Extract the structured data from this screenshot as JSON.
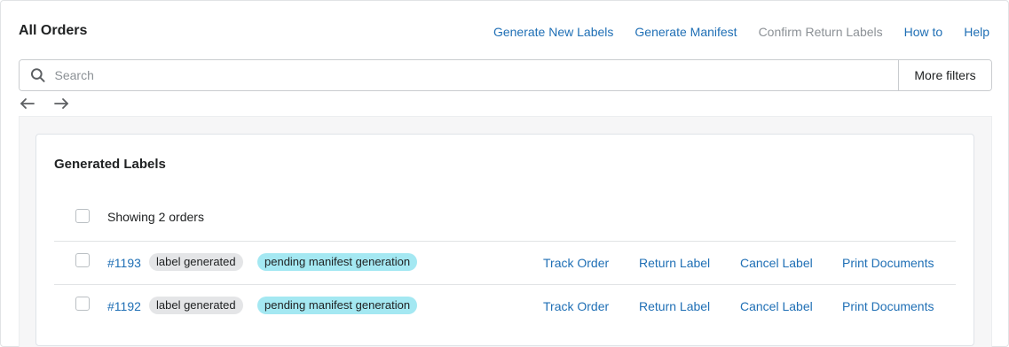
{
  "header": {
    "title": "All Orders",
    "actions": [
      {
        "label": "Generate New Labels",
        "enabled": true
      },
      {
        "label": "Generate Manifest",
        "enabled": true
      },
      {
        "label": "Confirm Return Labels",
        "enabled": false
      },
      {
        "label": "How to",
        "enabled": true
      },
      {
        "label": "Help",
        "enabled": true
      }
    ]
  },
  "search": {
    "placeholder": "Search",
    "value": "",
    "more_filters_label": "More filters"
  },
  "pager": {
    "prev_icon": "arrow-left-icon",
    "next_icon": "arrow-right-icon"
  },
  "card": {
    "title": "Generated Labels",
    "showing_text": "Showing 2 orders",
    "rows": [
      {
        "order": "#1193",
        "status_badge": "label generated",
        "manifest_badge": "pending manifest generation",
        "actions": [
          "Track Order",
          "Return Label",
          "Cancel Label",
          "Print Documents"
        ]
      },
      {
        "order": "#1192",
        "status_badge": "label generated",
        "manifest_badge": "pending manifest generation",
        "actions": [
          "Track Order",
          "Return Label",
          "Cancel Label",
          "Print Documents"
        ]
      }
    ]
  },
  "colors": {
    "link": "#1f6fb5",
    "disabled_link": "#8c9196",
    "badge_gray": "#e4e5e7",
    "badge_blue": "#a4e8f2"
  }
}
